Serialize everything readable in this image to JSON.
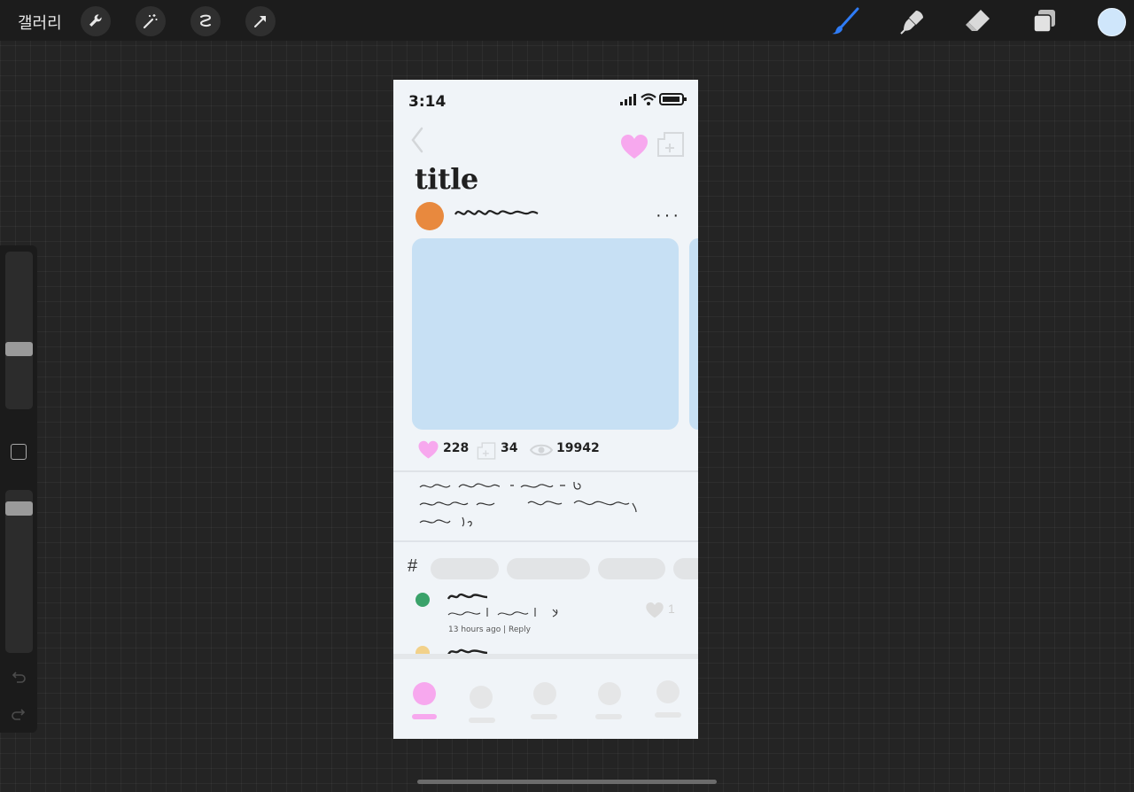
{
  "toolbar": {
    "gallery_label": "갤러리",
    "left_tools": [
      "wrench-icon",
      "magic-wand-icon",
      "selection-icon",
      "transform-arrow-icon"
    ],
    "right_tools": [
      "brush-icon",
      "smudge-icon",
      "eraser-icon",
      "layers-icon"
    ],
    "active_tool": "brush-icon",
    "accent": "#2f7cf6",
    "current_color": "#cfe6fb"
  },
  "sidebar": {
    "brush_size_level": 0.37,
    "opacity_level": 0.08
  },
  "canvas": {
    "status": {
      "time": "3:14"
    },
    "post": {
      "title": "title",
      "avatar_color": "#e8893e",
      "more": "···",
      "image_color": "#c7e0f4",
      "stats": {
        "likes": "228",
        "saves": "34",
        "views": "19942"
      },
      "like_color": "#f7a8ee"
    },
    "comments": {
      "hash": "#",
      "meta": "13 hours ago | Reply",
      "like_count": "1"
    },
    "nav": {
      "active_color": "#f7a8ee"
    }
  }
}
